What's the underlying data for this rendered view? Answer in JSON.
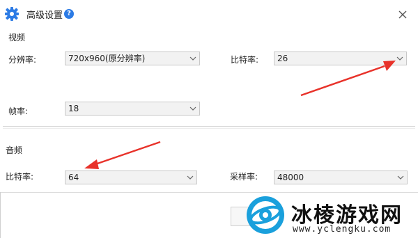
{
  "dialog": {
    "title": "高级设置",
    "help_icon_text": "?",
    "close_symbol": "×"
  },
  "video": {
    "section_label": "视频",
    "resolution_label": "分辨率:",
    "resolution_value": "720x960(原分辨率)",
    "bitrate_label": "比特率:",
    "bitrate_value": "26",
    "framerate_label": "帧率:",
    "framerate_value": "18"
  },
  "audio": {
    "section_label": "音频",
    "bitrate_label": "比特率:",
    "bitrate_value": "64",
    "samplerate_label": "采样率:",
    "samplerate_value": "48000"
  },
  "watermark": {
    "brand_text": "冰棱游戏网",
    "url_text": "www.yclengku.com"
  },
  "colors": {
    "accent_blue": "#2c7be5",
    "arrow_red": "#e8322a",
    "watermark_blue": "#1aa0dc"
  },
  "icons": {
    "title_icon": "gear-icon",
    "help_icon": "question-circle-icon",
    "close_icon": "close-icon",
    "dropdown_icon": "chevron-down-icon"
  }
}
